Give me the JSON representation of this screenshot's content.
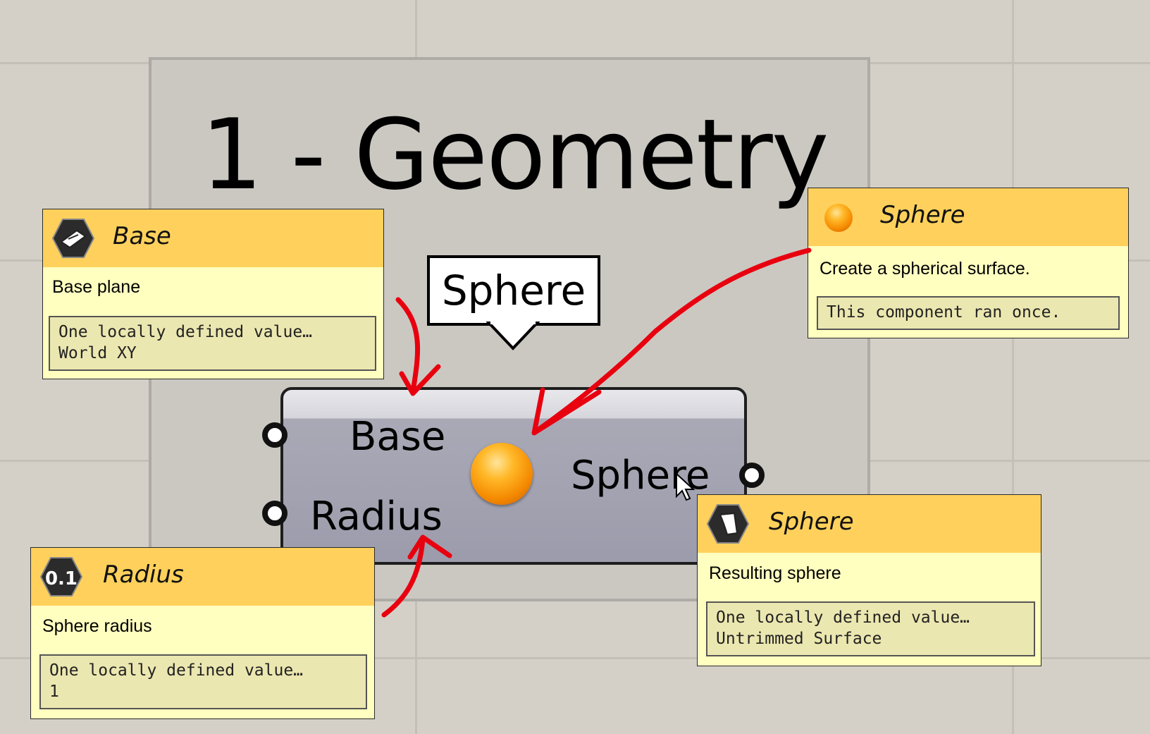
{
  "canvas": {
    "group_title": "1 - Geometry"
  },
  "component": {
    "balloon": "Sphere",
    "inputs": [
      "Base",
      "Radius"
    ],
    "output": "Sphere",
    "icon": "sphere-icon"
  },
  "tooltips": {
    "base": {
      "icon": "plane-icon",
      "title": "Base",
      "description": "Base plane",
      "value_line1": "One locally defined value…",
      "value_line2": "World XY"
    },
    "sphere_component": {
      "icon": "sphere-icon",
      "title": "Sphere",
      "description": "Create a spherical surface.",
      "value_line1": "This component ran once."
    },
    "radius": {
      "icon": "number-icon",
      "icon_text": "0.1",
      "title": "Radius",
      "description": "Sphere radius",
      "value_line1": "One locally defined value…",
      "value_line2": "1"
    },
    "sphere_output": {
      "icon": "surface-icon",
      "title": "Sphere",
      "description": "Resulting sphere",
      "value_line1": "One locally defined value…",
      "value_line2": "Untrimmed Surface"
    }
  },
  "colors": {
    "canvas": "#d4d0c8",
    "tooltip_header": "#ffd15c",
    "tooltip_body": "#ffffc0",
    "annotation": "#e8000f"
  }
}
